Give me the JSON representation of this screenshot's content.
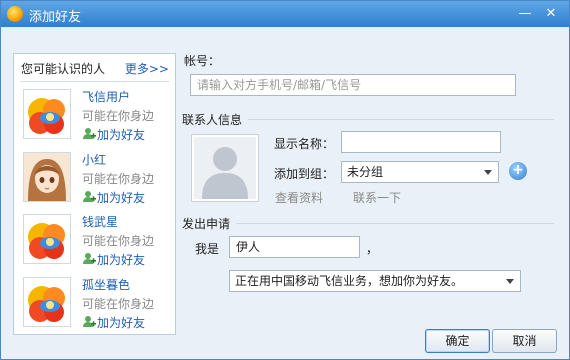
{
  "window": {
    "title": "添加好友"
  },
  "sidebar": {
    "title": "您可能认识的人",
    "more": "更多>>",
    "contacts": [
      {
        "name": "飞信用户",
        "subtitle": "可能在你身边",
        "add": "加为好友",
        "avatar": "default-flower-avatar"
      },
      {
        "name": "小红",
        "subtitle": "可能在你身边",
        "add": "加为好友",
        "avatar": "anime-girl-avatar"
      },
      {
        "name": "钱武星",
        "subtitle": "可能在你身边",
        "add": "加为好友",
        "avatar": "default-flower-avatar"
      },
      {
        "name": "孤坐暮色",
        "subtitle": "可能在你身边",
        "add": "加为好友",
        "avatar": "default-flower-avatar"
      }
    ]
  },
  "account": {
    "label": "帐号：",
    "placeholder": "请输入对方手机号/邮箱/飞信号"
  },
  "contact_info": {
    "label": "联系人信息",
    "display_name_label": "显示名称：",
    "display_name_value": "",
    "group_label": "添加到组：",
    "group_value": "未分组",
    "view_profile": "查看资料",
    "contact_once": "联系一下"
  },
  "request": {
    "label": "发出申请",
    "i_am_label": "我是",
    "i_am_value": "伊人",
    "comma": "，",
    "message_value": "正在用中国移动飞信业务，想加你为好友。"
  },
  "buttons": {
    "ok": "确定",
    "cancel": "取消"
  },
  "colors": {
    "titlebar": "#3b8ad8",
    "link": "#1f5fb5",
    "background": "#e9f0f7"
  }
}
